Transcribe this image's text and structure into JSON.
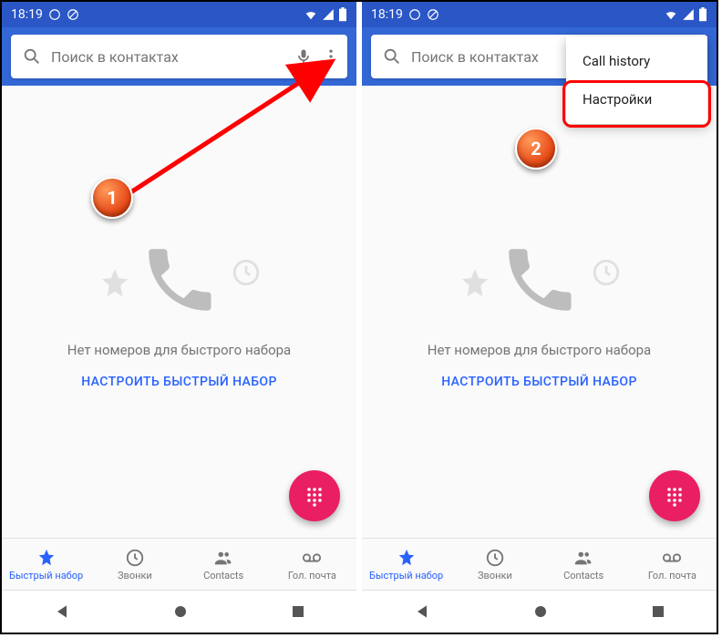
{
  "statusbar": {
    "time": "18:19"
  },
  "search": {
    "placeholder": "Поиск в контактах"
  },
  "empty": {
    "message": "Нет номеров для быстрого набора",
    "action": "НАСТРОИТЬ БЫСТРЫЙ НАБОР"
  },
  "tabs": {
    "speed_dial": "Быстрый набор",
    "calls": "Звонки",
    "contacts": "Contacts",
    "voicemail": "Гол. почта"
  },
  "popup": {
    "call_history": "Call history",
    "settings": "Настройки"
  },
  "badges": {
    "one": "1",
    "two": "2"
  }
}
